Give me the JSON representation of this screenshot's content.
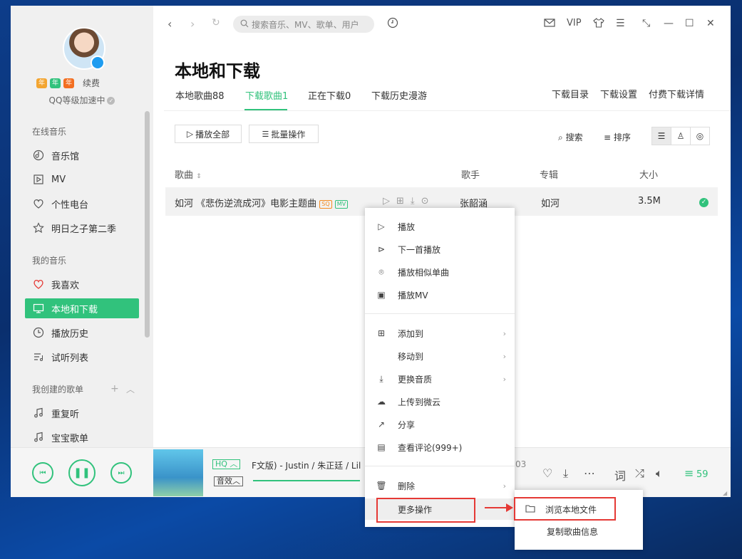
{
  "sidebar": {
    "badges": [
      "年",
      "年",
      "年"
    ],
    "renew": "续费",
    "level": "QQ等级加速中",
    "online_title": "在线音乐",
    "online_items": [
      "音乐馆",
      "MV",
      "个性电台",
      "明日之子第二季"
    ],
    "my_title": "我的音乐",
    "my_items": [
      "我喜欢",
      "本地和下载",
      "播放历史",
      "试听列表"
    ],
    "created_title": "我创建的歌单",
    "created_items": [
      "重复听",
      "宝宝歌单"
    ]
  },
  "topbar": {
    "search_placeholder": "搜索音乐、MV、歌单、用户",
    "vip": "VIP"
  },
  "page": {
    "title": "本地和下载",
    "tabs": [
      "本地歌曲88",
      "下载歌曲1",
      "正在下载0",
      "下载历史漫游"
    ],
    "right_links": [
      "下载目录",
      "下载设置",
      "付费下载详情"
    ],
    "play_all": "播放全部",
    "batch": "批量操作",
    "search": "搜索",
    "sort": "排序"
  },
  "table": {
    "headers": [
      "歌曲",
      "歌手",
      "专辑",
      "大小"
    ],
    "rows": [
      {
        "song": "如河 《悲伤逆流成河》电影主题曲",
        "tag_sq": "SQ",
        "tag_mv": "MV",
        "singer": "张韶涵",
        "album": "如河",
        "size": "3.5M"
      }
    ]
  },
  "player": {
    "quality": "HQ",
    "effect": "音效",
    "song_line": "F文版) - Justin / 朱正廷 / Lil",
    "time_suffix": "03",
    "playlist_count": "59"
  },
  "context_menu": {
    "items": [
      "播放",
      "下一首播放",
      "播放相似单曲",
      "播放MV",
      "添加到",
      "移动到",
      "更换音质",
      "上传到微云",
      "分享",
      "查看评论(999+)",
      "删除",
      "更多操作"
    ]
  },
  "submenu": {
    "items": [
      "浏览本地文件",
      "复制歌曲信息"
    ]
  },
  "colors": {
    "accent": "#31c27c",
    "highlight": "#e53935"
  }
}
